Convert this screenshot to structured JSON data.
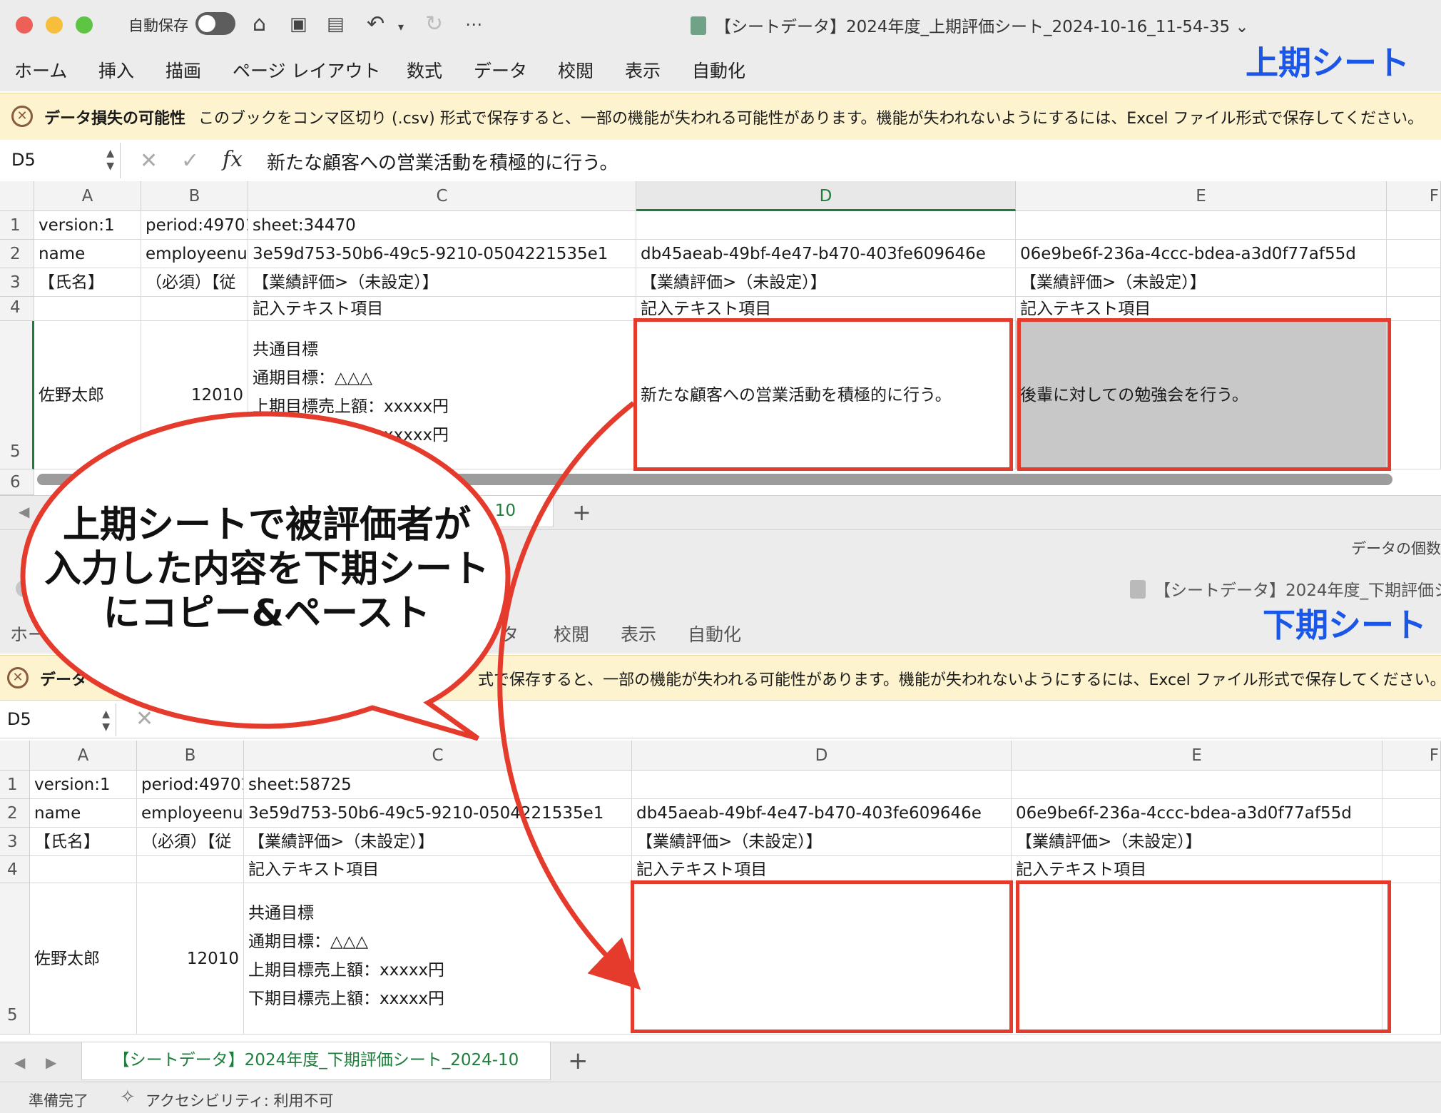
{
  "top_window": {
    "autosave_label": "自動保存",
    "doc_title": "【シートデータ】2024年度_上期評価シート_2024-10-16_11-54-35",
    "ribbon_tabs": [
      "ホーム",
      "挿入",
      "描画",
      "ページ レイアウト",
      "数式",
      "データ",
      "校閲",
      "表示",
      "自動化"
    ],
    "sheet_label": "上期シート",
    "info_bold": "データ損失の可能性",
    "info_msg": "このブックをコンマ区切り (.csv) 形式で保存すると、一部の機能が失われる可能性があります。機能が失われないようにするには、Excel ファイル形式で保存してください。",
    "name_box": "D5",
    "formula": "新たな顧客への営業活動を積極的に行う。",
    "columns": [
      "A",
      "B",
      "C",
      "D",
      "E",
      "F"
    ],
    "row_numbers": [
      "1",
      "2",
      "3",
      "4",
      "5",
      "6"
    ],
    "rows": [
      [
        "version:1",
        "period:49701",
        "sheet:34470",
        "",
        ""
      ],
      [
        "name",
        "employeenur",
        "3e59d753-50b6-49c5-9210-0504221535e1",
        "db45aeab-49bf-4e47-b470-403fe609646e",
        "06e9be6f-236a-4ccc-bdea-a3d0f77af55d"
      ],
      [
        "【氏名】",
        "（必須）【従",
        "【業績評価>（未設定）】",
        "【業績評価>（未設定）】",
        "【業績評価>（未設定）】"
      ],
      [
        "",
        "",
        "記入テキスト項目",
        "記入テキスト項目",
        "記入テキスト項目"
      ],
      [
        "佐野太郎",
        "12010",
        "共通目標\n通期目標：△△△\n上期目標売上額：xxxxx円\n下期目標売上額：xxxxx円",
        "新たな顧客への営業活動を積極的に行う。",
        "後輩に対しての勉強会を行う。"
      ]
    ],
    "tab_fragment": "10",
    "status_right": "データの個数"
  },
  "bottom_window": {
    "doc_title": "【シートデータ】2024年度_下期評価シ",
    "ribbon_tabs": [
      "ホー",
      "タ",
      "校閲",
      "表示",
      "自動化"
    ],
    "sheet_label": "下期シート",
    "info_bold": "データ",
    "info_msg": "式で保存すると、一部の機能が失われる可能性があります。機能が失われないようにするには、Excel ファイル形式で保存してください。",
    "name_box": "D5",
    "columns": [
      "A",
      "B",
      "C",
      "D",
      "E",
      "F"
    ],
    "row_numbers": [
      "1",
      "2",
      "3",
      "4",
      "5"
    ],
    "rows": [
      [
        "version:1",
        "period:49701",
        "sheet:58725",
        "",
        ""
      ],
      [
        "name",
        "employeenur",
        "3e59d753-50b6-49c5-9210-0504221535e1",
        "db45aeab-49bf-4e47-b470-403fe609646e",
        "06e9be6f-236a-4ccc-bdea-a3d0f77af55d"
      ],
      [
        "【氏名】",
        "（必須）【従",
        "【業績評価>（未設定）】",
        "【業績評価>（未設定）】",
        "【業績評価>（未設定）】"
      ],
      [
        "",
        "",
        "記入テキスト項目",
        "記入テキスト項目",
        "記入テキスト項目"
      ],
      [
        "佐野太郎",
        "12010",
        "共通目標\n通期目標：△△△\n上期目標売上額：xxxxx円\n下期目標売上額：xxxxx円",
        "",
        ""
      ]
    ],
    "sheet_tab": "【シートデータ】2024年度_下期評価シート_2024-10",
    "status_ready": "準備完了",
    "status_accessibility": "アクセシビリティ: 利用不可"
  },
  "callout": {
    "lines": [
      "上期シートで被評価者が",
      "入力した内容を下期シート",
      "にコピー&ペースト"
    ]
  },
  "colors": {
    "accent_red": "#e53b2d",
    "label_blue": "#1a56e8",
    "excel_green": "#1d7d3a"
  }
}
